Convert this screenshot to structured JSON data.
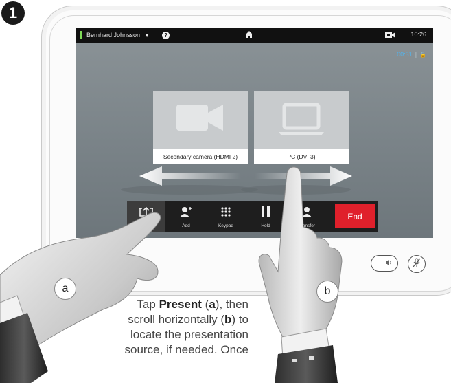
{
  "step_number": "1",
  "status_bar": {
    "caller_name": "Bernhard Johnsson",
    "caret": "▼",
    "help": "?",
    "home_icon": "home-icon",
    "camera_icon": "camera-icon",
    "time": "10:26"
  },
  "call": {
    "duration": "00:31",
    "encrypted_icon": "lock-icon"
  },
  "sources": [
    {
      "label": "Secondary camera (HDMI 2)",
      "icon": "video-camera-icon"
    },
    {
      "label": "PC (DVI 3)",
      "icon": "laptop-icon"
    }
  ],
  "toolbar": {
    "present_label": "",
    "add_label": "Add",
    "keypad_label": "Keypad",
    "hold_label": "Hold",
    "transfer_label": "Transfer",
    "end_label": "End"
  },
  "callouts": {
    "a": "a",
    "b": "b"
  },
  "instruction": {
    "pre": "Tap ",
    "present": "Present",
    "mid1": " (",
    "a": "a",
    "mid2": "), then scroll horizontally (",
    "b": "b",
    "post": ") to locate the presentation source, if needed. Once"
  },
  "colors": {
    "end_button": "#e0202b",
    "duration_text": "#4fb5f0",
    "status_mark": "#7ed957"
  }
}
